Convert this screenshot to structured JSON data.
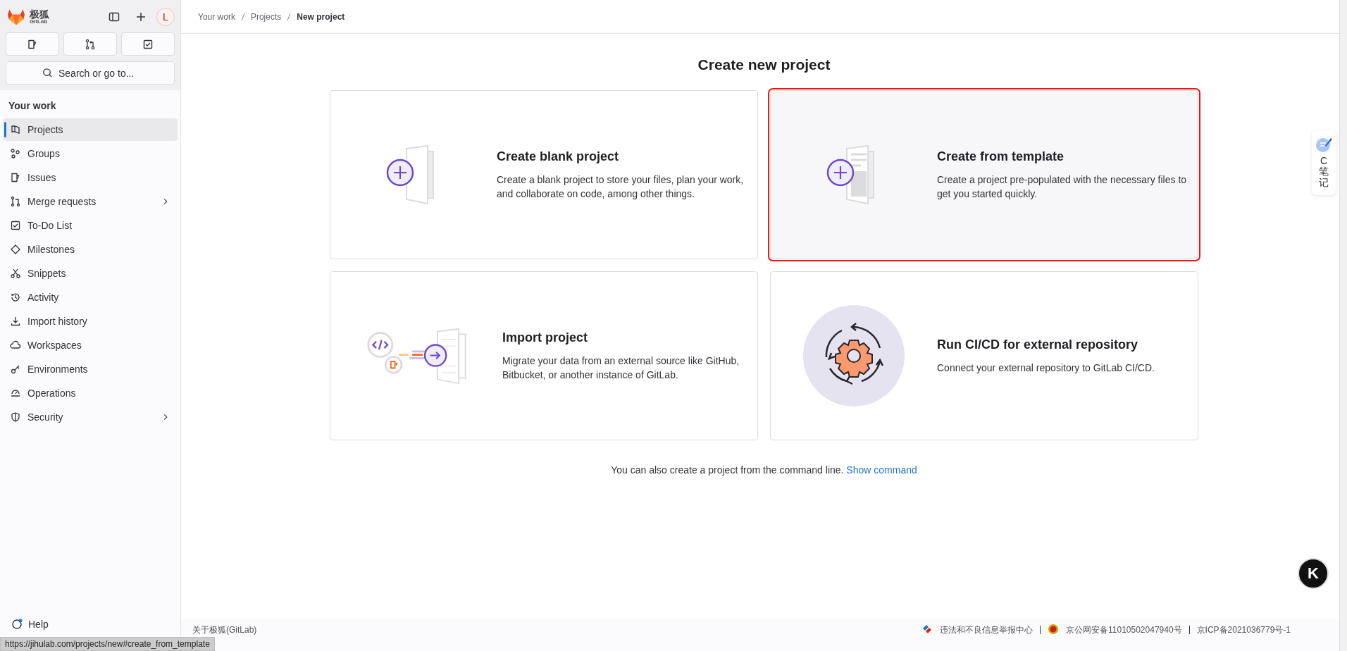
{
  "sidebar": {
    "logo_text": "极狐",
    "logo_subtext": "GitLab",
    "avatar": "L",
    "search": {
      "placeholder": "Search or go to..."
    },
    "section_title": "Your work",
    "items": [
      {
        "label": "Projects",
        "selected": true,
        "has_submenu": false
      },
      {
        "label": "Groups",
        "selected": false,
        "has_submenu": false
      },
      {
        "label": "Issues",
        "selected": false,
        "has_submenu": false
      },
      {
        "label": "Merge requests",
        "selected": false,
        "has_submenu": true
      },
      {
        "label": "To-Do List",
        "selected": false,
        "has_submenu": false
      },
      {
        "label": "Milestones",
        "selected": false,
        "has_submenu": false
      },
      {
        "label": "Snippets",
        "selected": false,
        "has_submenu": false
      },
      {
        "label": "Activity",
        "selected": false,
        "has_submenu": false
      },
      {
        "label": "Import history",
        "selected": false,
        "has_submenu": false
      },
      {
        "label": "Workspaces",
        "selected": false,
        "has_submenu": false
      },
      {
        "label": "Environments",
        "selected": false,
        "has_submenu": false
      },
      {
        "label": "Operations",
        "selected": false,
        "has_submenu": false
      },
      {
        "label": "Security",
        "selected": false,
        "has_submenu": true
      }
    ],
    "help": "Help"
  },
  "breadcrumbs": [
    {
      "label": "Your work",
      "current": false
    },
    {
      "label": "Projects",
      "current": false
    },
    {
      "label": "New project",
      "current": true
    }
  ],
  "page_title": "Create new project",
  "cards": [
    {
      "title": "Create blank project",
      "description": "Create a blank project to store your files, plan your work, and collaborate on code, among other things.",
      "selected": false
    },
    {
      "title": "Create from template",
      "description": "Create a project pre-populated with the necessary files to get you started quickly.",
      "selected": true
    },
    {
      "title": "Import project",
      "description": "Migrate your data from an external source like GitHub, Bitbucket, or another instance of GitLab.",
      "selected": false
    },
    {
      "title": "Run CI/CD for external repository",
      "description": "Connect your external repository to GitLab CI/CD.",
      "selected": false
    }
  ],
  "command_line": {
    "text": "You can also create a project from the command line.",
    "link": "Show command"
  },
  "footer": {
    "about": "关于极狐(GitLab)",
    "links": [
      "违法和不良信息举报中心",
      "京公网安备11010502047940号",
      "京ICP备2021036779号-1"
    ]
  },
  "side_widget": {
    "label": "C笔记"
  },
  "floating_badge": "K",
  "status_bar": "https://jihulab.com/projects/new#create_from_template"
}
